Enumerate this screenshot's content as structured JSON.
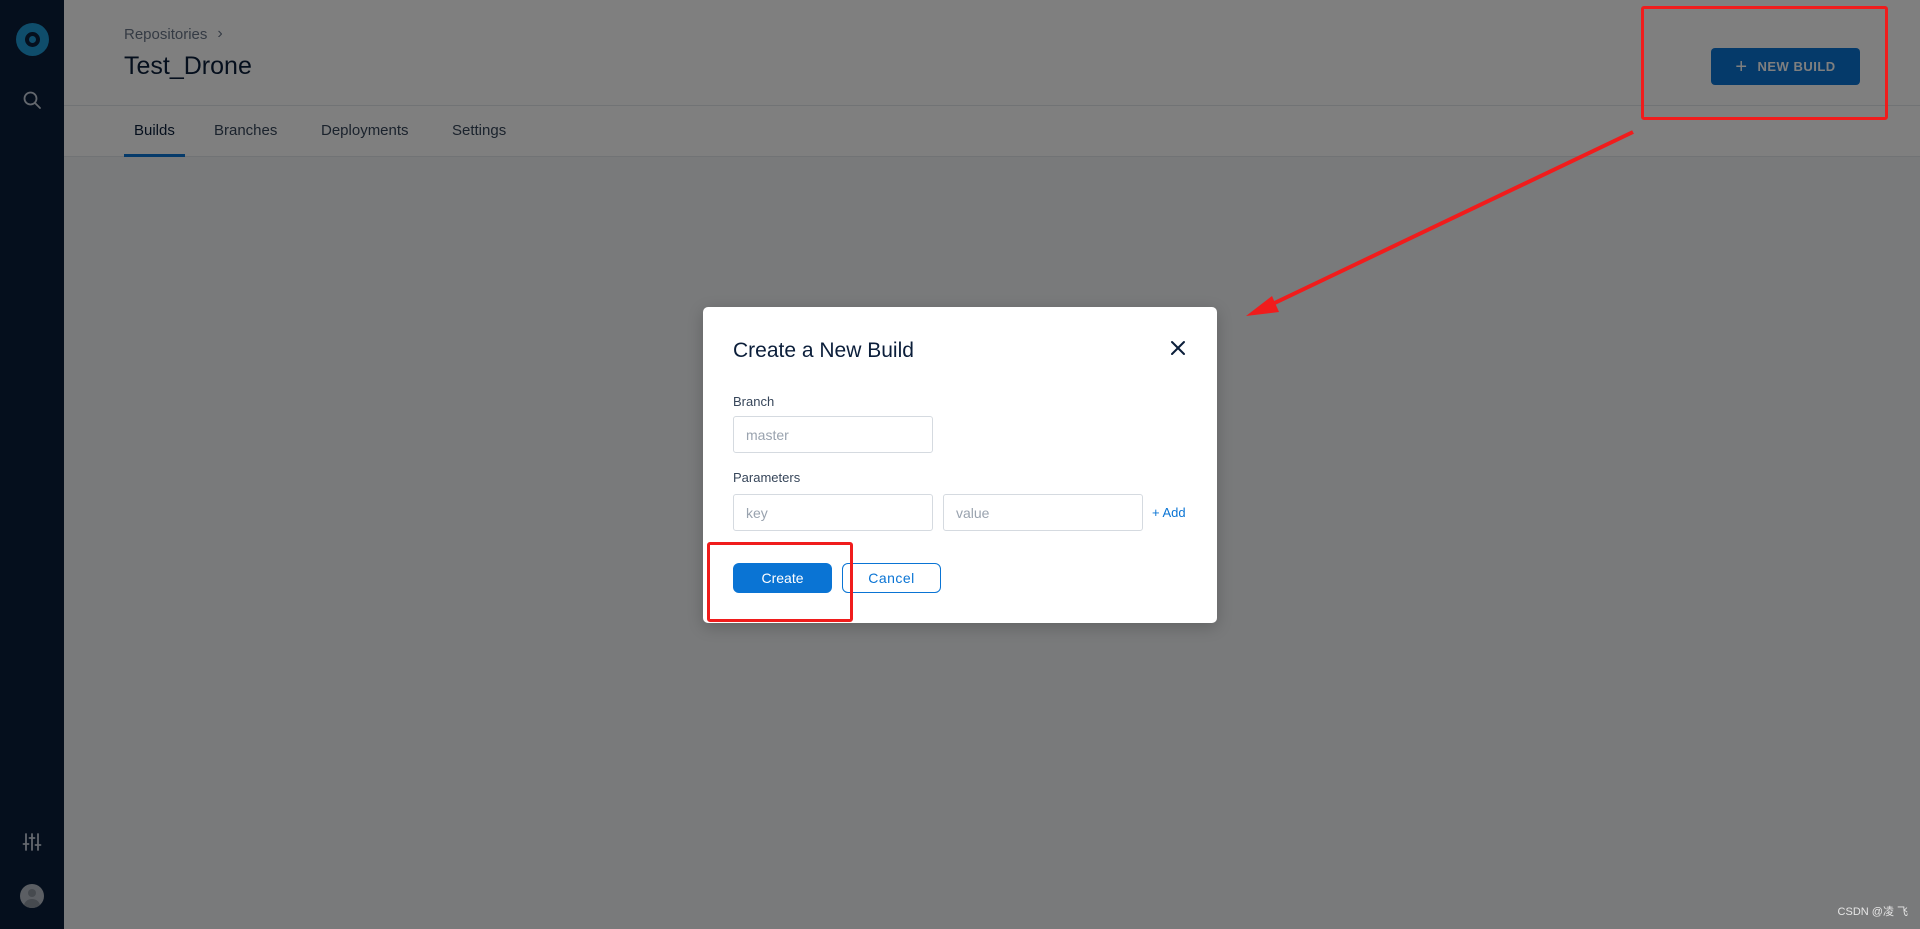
{
  "breadcrumb": {
    "label": "Repositories"
  },
  "page": {
    "title": "Test_Drone"
  },
  "header": {
    "new_build_label": "NEW BUILD"
  },
  "tabs": [
    {
      "label": "Builds",
      "active": true
    },
    {
      "label": "Branches",
      "active": false
    },
    {
      "label": "Deployments",
      "active": false
    },
    {
      "label": "Settings",
      "active": false
    }
  ],
  "modal": {
    "title": "Create a New Build",
    "branch_label": "Branch",
    "branch_placeholder": "master",
    "parameters_label": "Parameters",
    "key_placeholder": "key",
    "value_placeholder": "value",
    "add_label": "+ Add",
    "create_label": "Create",
    "cancel_label": "Cancel"
  },
  "watermark": "CSDN @凌 飞",
  "colors": {
    "accent": "#0a74d4",
    "sidebar": "#0b1e3a",
    "annotation": "#f01c1c"
  },
  "icons": {
    "logo": "drone-logo-icon",
    "search": "search-icon",
    "settings": "sliders-icon",
    "avatar": "user-avatar-icon",
    "close": "close-icon",
    "plus": "plus-icon"
  }
}
